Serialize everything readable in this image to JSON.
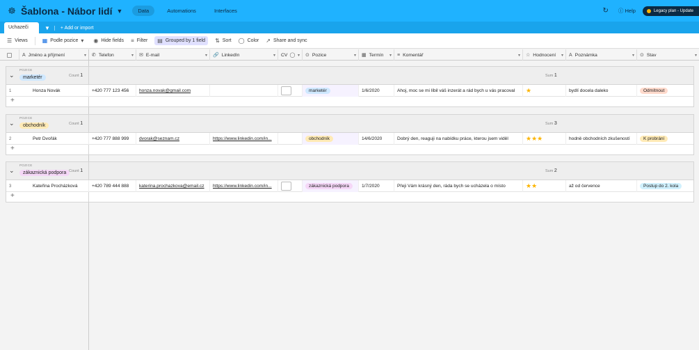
{
  "topbar": {
    "title": "Šablona - Nábor lidí",
    "nav": [
      "Data",
      "Automations",
      "Interfaces"
    ],
    "help": "Help",
    "legacy": "Legacy plan - Update"
  },
  "tabs": {
    "active": "Uchazeči",
    "add_import": "Add or import"
  },
  "viewbar": {
    "views": "Views",
    "view_name": "Podle pozice",
    "hide_fields": "Hide fields",
    "filter": "Filter",
    "grouped": "Grouped by 1 field",
    "sort": "Sort",
    "color": "Color",
    "share": "Share and sync"
  },
  "columns": [
    "Jméno a příjmení",
    "Telefon",
    "E-mail",
    "LinkedIn",
    "CV",
    "Pozice",
    "Termín",
    "Komentář",
    "Hodnocení",
    "Poznámka",
    "Stav"
  ],
  "group_label": "POZICE",
  "count_label": "Count",
  "sum_label": "Sum",
  "groups": [
    {
      "name": "marketér",
      "color": "#cfe8ff",
      "count": "1",
      "sum": "1",
      "rows": [
        {
          "num": "1",
          "name": "Honza Novák",
          "phone": "+420 777 123 456",
          "email": "honza.novak@gmail.com",
          "linkedin": "",
          "pozice": "marketér",
          "pozice_color": "#cfe8ff",
          "termin": "1/6/2020",
          "komentar": "Ahoj, moc se mi líbil váš inzerát a rád bych u vás pracoval",
          "rating": 1,
          "poznamka": "bydlí docela daleko",
          "stav": "Odmítnout",
          "stav_color": "#ffdacc"
        }
      ]
    },
    {
      "name": "obchodník",
      "color": "#ffeab6",
      "count": "1",
      "sum": "3",
      "rows": [
        {
          "num": "2",
          "name": "Petr Dvořák",
          "phone": "+420 777 888 999",
          "email": "dvorak@seznam.cz",
          "linkedin": "https://www.linkedin.com/in...",
          "pozice": "obchodník",
          "pozice_color": "#ffeab6",
          "termin": "14/6/2020",
          "komentar": "Dobrý den, reaguji na nabídku práce, kterou jsem viděl",
          "rating": 3,
          "poznamka": "hodně obchodních zkušeností",
          "stav": "K probrání",
          "stav_color": "#ffeab6"
        }
      ]
    },
    {
      "name": "zákaznická podpora",
      "color": "#f5d7f7",
      "count": "1",
      "sum": "2",
      "rows": [
        {
          "num": "3",
          "name": "Kateřina Procházková",
          "phone": "+420 789 444 888",
          "email": "katerina.prochazkova@email.cz",
          "linkedin": "https://www.linkedin.com/in...",
          "pozice": "zákaznická podpora",
          "pozice_color": "#f5d7f7",
          "termin": "1/7/2020",
          "komentar": "Přeji Vám krásný den, ráda bych se ucházela o místo",
          "rating": 2,
          "poznamka": "až od července",
          "stav": "Postup do 2. kola",
          "stav_color": "#d0f0fd"
        }
      ]
    }
  ]
}
